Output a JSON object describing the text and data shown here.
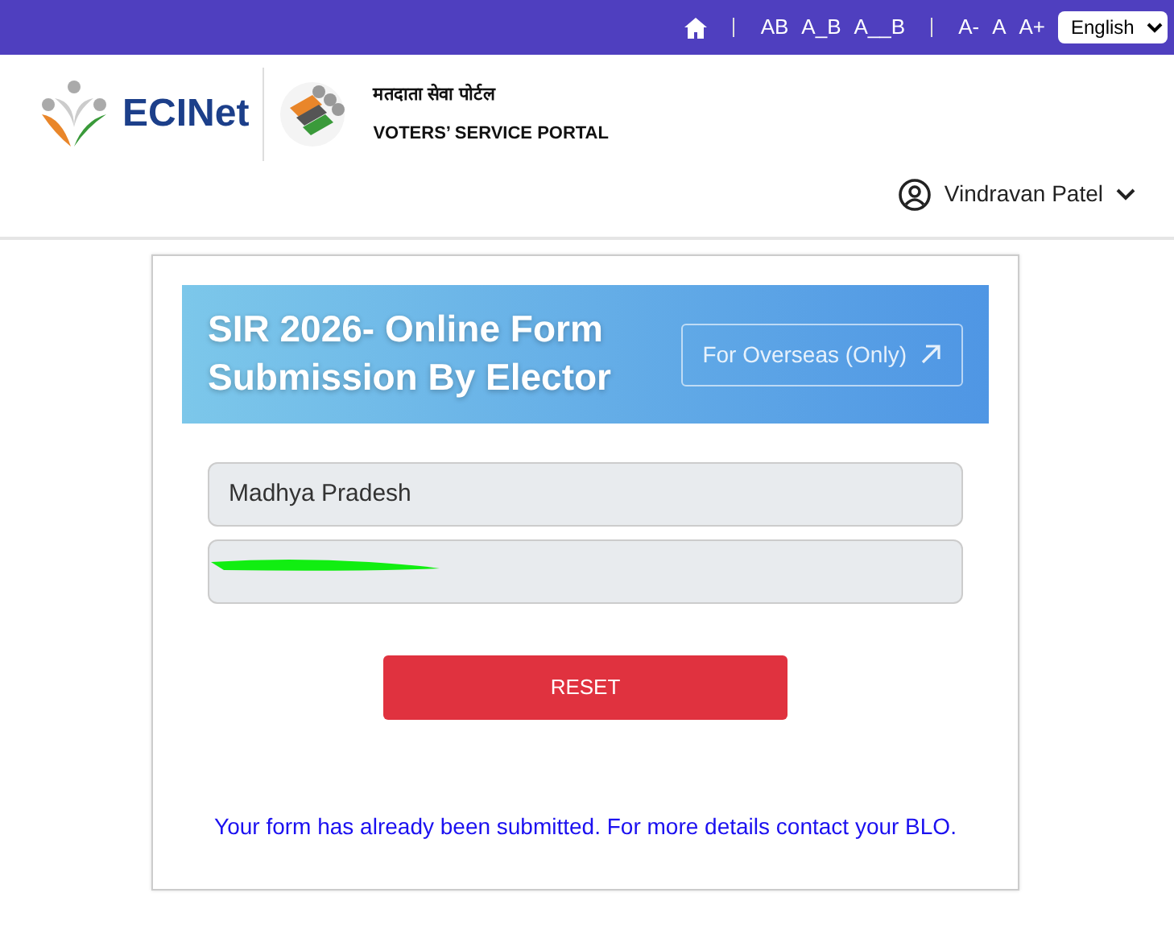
{
  "topbar": {
    "size_options": [
      "AB",
      "A_B",
      "A__B"
    ],
    "font_options": [
      "A-",
      "A",
      "A+"
    ],
    "language": "English"
  },
  "header": {
    "brand": "ECINet",
    "portal_title_hindi": "मतदाता सेवा पोर्टल",
    "portal_title": "VOTERS’ SERVICE PORTAL"
  },
  "user": {
    "name": "Vindravan Patel"
  },
  "form": {
    "title": "SIR 2026- Online Form Submission By Elector",
    "overseas_button": "For Overseas (Only)",
    "state": "Madhya Pradesh",
    "number_redacted": true,
    "reset_button": "RESET",
    "message": "Your form has already been submitted. For more details contact your BLO."
  }
}
